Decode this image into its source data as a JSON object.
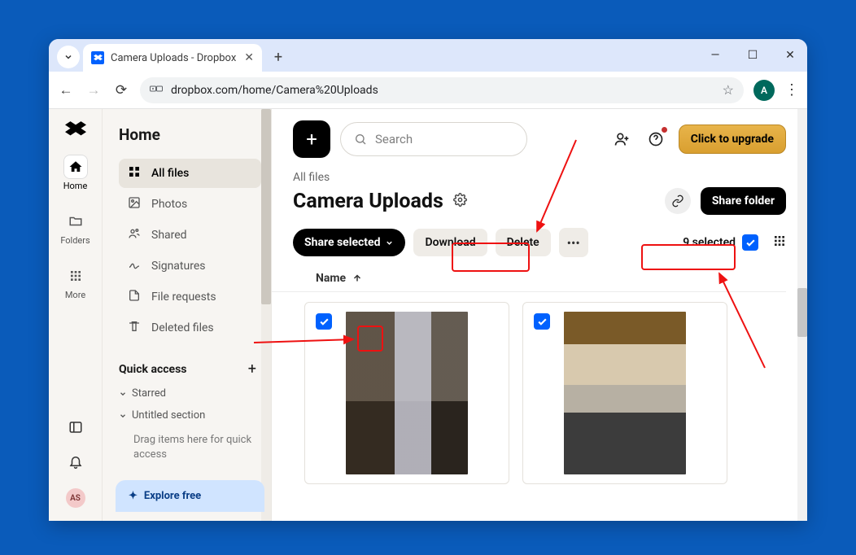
{
  "browser": {
    "tab_title": "Camera Uploads - Dropbox",
    "url": "dropbox.com/home/Camera%20Uploads",
    "profile_initial": "A"
  },
  "rail": {
    "items": [
      {
        "label": "Home"
      },
      {
        "label": "Folders"
      },
      {
        "label": "More"
      }
    ],
    "avatar_initials": "AS"
  },
  "sidebar": {
    "title": "Home",
    "items": [
      {
        "label": "All files"
      },
      {
        "label": "Photos"
      },
      {
        "label": "Shared"
      },
      {
        "label": "Signatures"
      },
      {
        "label": "File requests"
      },
      {
        "label": "Deleted files"
      }
    ],
    "quick_access_label": "Quick access",
    "starred_label": "Starred",
    "untitled_label": "Untitled section",
    "drag_hint": "Drag items here for quick access",
    "explore_label": "Explore free"
  },
  "main": {
    "search_placeholder": "Search",
    "upgrade_label": "Click to upgrade",
    "breadcrumb": "All files",
    "folder_title": "Camera Uploads",
    "share_folder_label": "Share folder",
    "share_selected_label": "Share selected",
    "download_label": "Download",
    "delete_label": "Delete",
    "selected_label": "9 selected",
    "name_header": "Name"
  }
}
